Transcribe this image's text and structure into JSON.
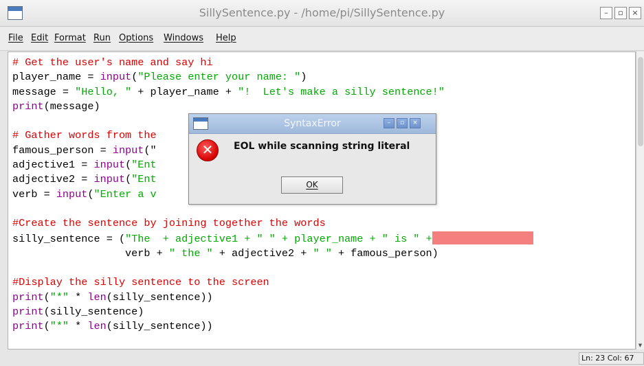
{
  "window": {
    "title": "SillySentence.py - /home/pi/SillySentence.py",
    "controls": {
      "minimize": "–",
      "maximize": "▫",
      "close": "×"
    }
  },
  "menu": [
    "File",
    "Edit",
    "Format",
    "Run",
    "Options",
    "Windows",
    "Help"
  ],
  "code": [
    [
      [
        "# Get the user's name and say hi",
        "comment"
      ]
    ],
    [
      [
        "player_name = ",
        "plain"
      ],
      [
        "input",
        "builtin"
      ],
      [
        "(",
        "plain"
      ],
      [
        "\"Please enter your name: \"",
        "string"
      ],
      [
        ")",
        "plain"
      ]
    ],
    [
      [
        "message = ",
        "plain"
      ],
      [
        "\"Hello, \"",
        "string"
      ],
      [
        " + player_name + ",
        "plain"
      ],
      [
        "\"!  Let's make a silly sentence!\"",
        "string"
      ]
    ],
    [
      [
        "print",
        "builtin"
      ],
      [
        "(message)",
        "plain"
      ]
    ],
    [],
    [
      [
        "# Gather words from the",
        "comment"
      ]
    ],
    [
      [
        "famous_person = ",
        "plain"
      ],
      [
        "input",
        "builtin"
      ],
      [
        "(\"",
        "plain"
      ],
      [
        "                                      ",
        "plain"
      ],
      [
        "n: \")",
        "plain"
      ]
    ],
    [
      [
        "adjective1 = ",
        "plain"
      ],
      [
        "input",
        "builtin"
      ],
      [
        "(",
        "plain"
      ],
      [
        "\"Ent",
        "string"
      ]
    ],
    [
      [
        "adjective2 = ",
        "plain"
      ],
      [
        "input",
        "builtin"
      ],
      [
        "(",
        "plain"
      ],
      [
        "\"Ent",
        "string"
      ]
    ],
    [
      [
        "verb = ",
        "plain"
      ],
      [
        "input",
        "builtin"
      ],
      [
        "(",
        "plain"
      ],
      [
        "\"Enter a v",
        "string"
      ]
    ],
    [],
    [
      [
        "#Create the sentence by joining together the words",
        "comment"
      ]
    ],
    [
      [
        "silly_sentence = (",
        "plain"
      ],
      [
        "\"The  + adjective1 + \" \" + player_name + \" is \" +",
        "string"
      ],
      [
        "",
        "error"
      ]
    ],
    [
      [
        "                  verb + ",
        "plain"
      ],
      [
        "\" the \"",
        "string"
      ],
      [
        " + adjective2 + ",
        "plain"
      ],
      [
        "\" \"",
        "string"
      ],
      [
        " + famous_person)",
        "plain"
      ]
    ],
    [],
    [
      [
        "#Display the silly sentence to the screen",
        "comment"
      ]
    ],
    [
      [
        "print",
        "builtin"
      ],
      [
        "(",
        "plain"
      ],
      [
        "\"*\"",
        "string"
      ],
      [
        " * ",
        "plain"
      ],
      [
        "len",
        "builtin"
      ],
      [
        "(silly_sentence))",
        "plain"
      ]
    ],
    [
      [
        "print",
        "builtin"
      ],
      [
        "(silly_sentence)",
        "plain"
      ]
    ],
    [
      [
        "print",
        "builtin"
      ],
      [
        "(",
        "plain"
      ],
      [
        "\"*\"",
        "string"
      ],
      [
        " * ",
        "plain"
      ],
      [
        "len",
        "builtin"
      ],
      [
        "(silly_sentence))",
        "plain"
      ]
    ]
  ],
  "status": {
    "position": "Ln: 23 Col: 67"
  },
  "dialog": {
    "title": "SyntaxError",
    "message": "EOL while scanning string literal",
    "ok_label": "OK",
    "icon": "error-icon",
    "controls": {
      "minimize": "–",
      "maximize": "▫",
      "close": "×"
    }
  },
  "colors": {
    "comment": "#dd0000",
    "builtin": "#900090",
    "string": "#00aa00",
    "error_highlight": "#f47f7f",
    "dialog_titlebar": "#a8c0e0"
  }
}
